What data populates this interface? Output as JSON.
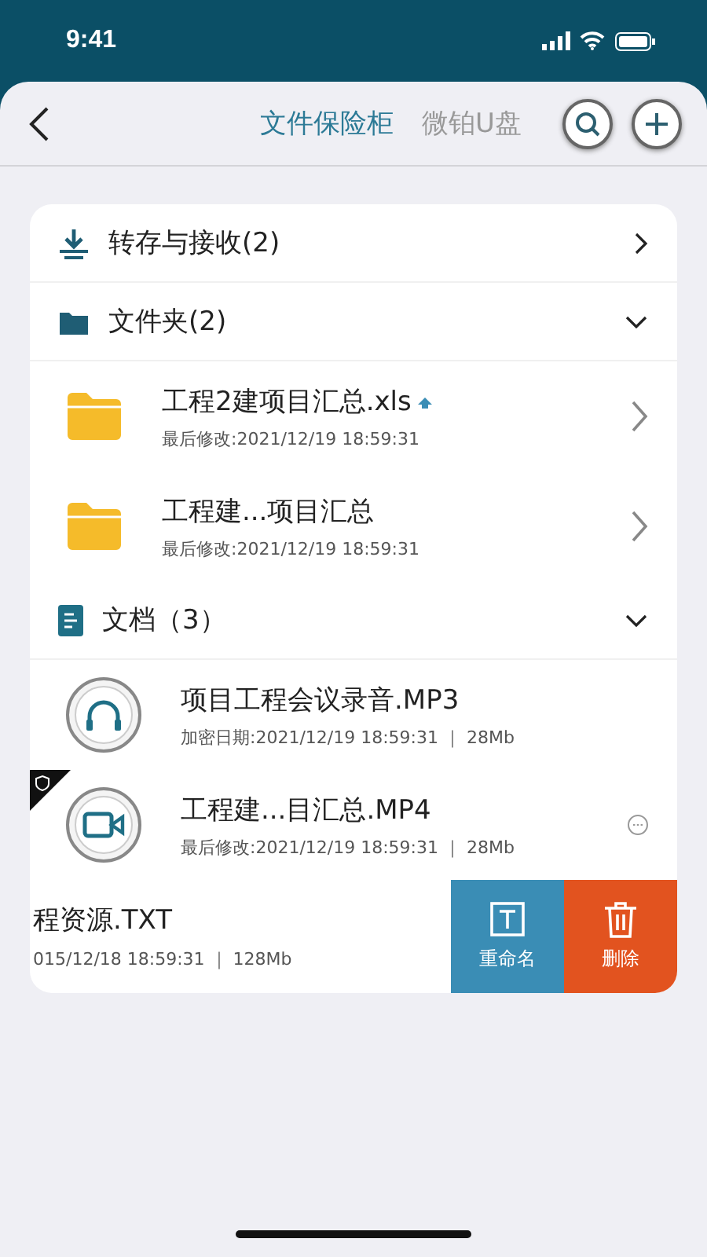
{
  "status_bar": {
    "time": "9:41"
  },
  "nav": {
    "tabs": [
      {
        "label": "文件保险柜",
        "selected": true
      },
      {
        "label": "微铂U盘",
        "selected": false
      }
    ]
  },
  "sections": [
    {
      "kind": "transfer",
      "title": "转存与接收(2)"
    },
    {
      "kind": "folders",
      "title": "文件夹(2)",
      "expanded": true,
      "items": [
        {
          "kind": "folder",
          "name": "工程2建项目汇总.xls",
          "meta": "最后修改:2021/12/19 18:59:31",
          "pinned": true
        },
        {
          "kind": "folder",
          "name": "工程建...项目汇总",
          "meta": "最后修改:2021/12/19 18:59:31",
          "pinned": false
        }
      ]
    },
    {
      "kind": "documents",
      "title": "文档（3）",
      "expanded": true,
      "items": [
        {
          "kind": "audio",
          "name": "项目工程会议录音.MP3",
          "meta": "加密日期:2021/12/19 18:59:31 ｜ 28Mb",
          "protected": false,
          "more": false
        },
        {
          "kind": "video",
          "name": "工程建...目汇总.MP4",
          "meta": "最后修改:2021/12/19 18:59:31 ｜ 28Mb",
          "protected": true,
          "more": true
        },
        {
          "name": "程资源.TXT",
          "meta": "015/12/18 18:59:31 ｜ 128Mb",
          "swiped": true,
          "actions": [
            {
              "kind": "rename",
              "label": "重命名"
            },
            {
              "kind": "delete",
              "label": "删除"
            }
          ]
        }
      ]
    }
  ]
}
